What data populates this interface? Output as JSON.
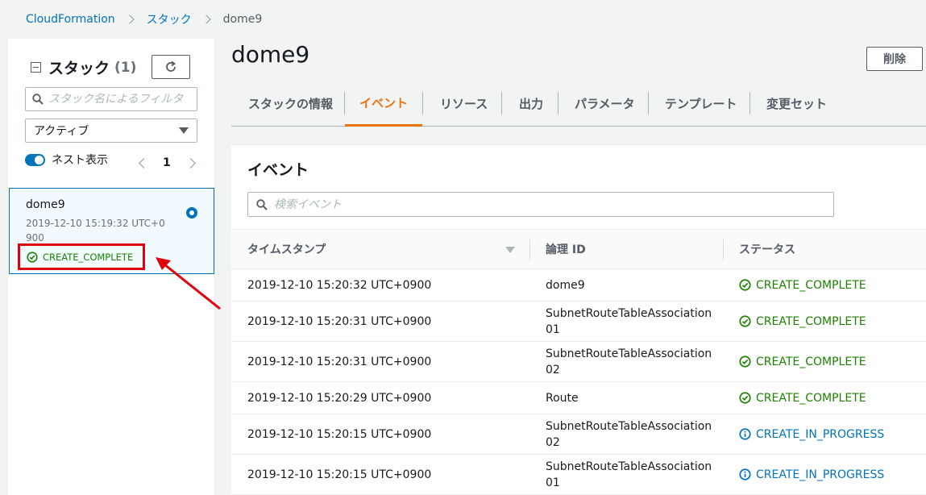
{
  "breadcrumb": {
    "root": "CloudFormation",
    "section": "スタック",
    "current": "dome9"
  },
  "sidebar": {
    "title": "スタック",
    "count": "(1)",
    "filter_placeholder": "スタック名によるフィルタ",
    "status_filter": "アクティブ",
    "nested_label": "ネスト表示",
    "nested_enabled": true,
    "page": "1",
    "stack": {
      "name": "dome9",
      "time": "2019-12-10 15:19:32 UTC+0900",
      "status": "CREATE_COMPLETE"
    }
  },
  "main": {
    "title": "dome9",
    "delete_label": "削除",
    "tabs": [
      {
        "label": "スタックの情報"
      },
      {
        "label": "イベント"
      },
      {
        "label": "リソース"
      },
      {
        "label": "出力"
      },
      {
        "label": "パラメータ"
      },
      {
        "label": "テンプレート"
      },
      {
        "label": "変更セット"
      }
    ],
    "active_tab": "イベント"
  },
  "events": {
    "title": "イベント",
    "search_placeholder": "検索イベント",
    "columns": [
      "タイムスタンプ",
      "論理 ID",
      "ステータス"
    ],
    "rows": [
      {
        "time": "2019-12-10 15:20:32 UTC+0900",
        "id": "dome9",
        "status": "CREATE_COMPLETE"
      },
      {
        "time": "2019-12-10 15:20:31 UTC+0900",
        "id": "SubnetRouteTableAssociation01",
        "status": "CREATE_COMPLETE"
      },
      {
        "time": "2019-12-10 15:20:31 UTC+0900",
        "id": "SubnetRouteTableAssociation02",
        "status": "CREATE_COMPLETE"
      },
      {
        "time": "2019-12-10 15:20:29 UTC+0900",
        "id": "Route",
        "status": "CREATE_COMPLETE"
      },
      {
        "time": "2019-12-10 15:20:15 UTC+0900",
        "id": "SubnetRouteTableAssociation02",
        "status": "CREATE_IN_PROGRESS"
      },
      {
        "time": "2019-12-10 15:20:15 UTC+0900",
        "id": "SubnetRouteTableAssociation01",
        "status": "CREATE_IN_PROGRESS"
      }
    ]
  },
  "colors": {
    "link": "#0073bb",
    "success": "#1d8102",
    "active_tab": "#ec7211",
    "highlight": "#e0030c"
  },
  "icons": [
    "chevron-right-icon",
    "collapse-icon",
    "refresh-icon",
    "search-icon",
    "caret-down-icon",
    "check-circle-icon",
    "info-circle-icon",
    "annotation-arrow"
  ]
}
